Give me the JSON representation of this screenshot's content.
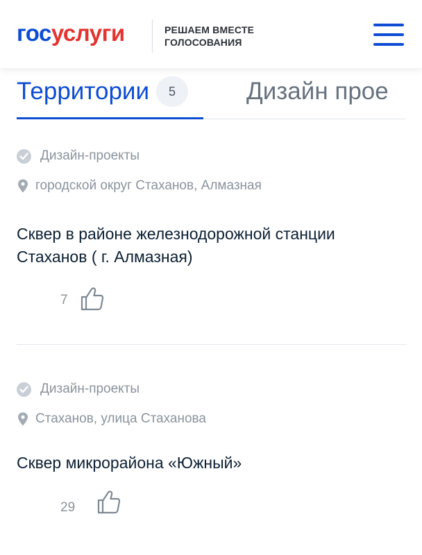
{
  "header": {
    "logo_part1": "гос",
    "logo_part2": "услуги",
    "tagline_line1": "РЕШАЕМ ВМЕСТЕ",
    "tagline_line2": "ГОЛОСОВАНИЯ",
    "menu_icon": "menu-icon"
  },
  "colors": {
    "brand_blue": "#0d4cd3",
    "brand_red": "#e3342f",
    "muted_text": "#8a939d",
    "primary_text": "#0b1f33"
  },
  "tabs": [
    {
      "label": "Территории",
      "count": "5",
      "active": true
    },
    {
      "label": "Дизайн прое",
      "active": false
    }
  ],
  "projects": [
    {
      "category": "Дизайн-проекты",
      "category_icon": "check-circle-icon",
      "location": "городской округ Стаханов, Алмазная",
      "location_icon": "map-pin-icon",
      "title": "Сквер в районе железнодорожной станции Стаханов ( г. Алмазная)",
      "likes": "7",
      "like_icon": "thumbs-up-icon"
    },
    {
      "category": "Дизайн-проекты",
      "category_icon": "check-circle-icon",
      "location": "Стаханов, улица Стаханова",
      "location_icon": "map-pin-icon",
      "title": "Сквер микрорайона «Южный»",
      "likes": "29",
      "like_icon": "thumbs-up-icon"
    }
  ]
}
